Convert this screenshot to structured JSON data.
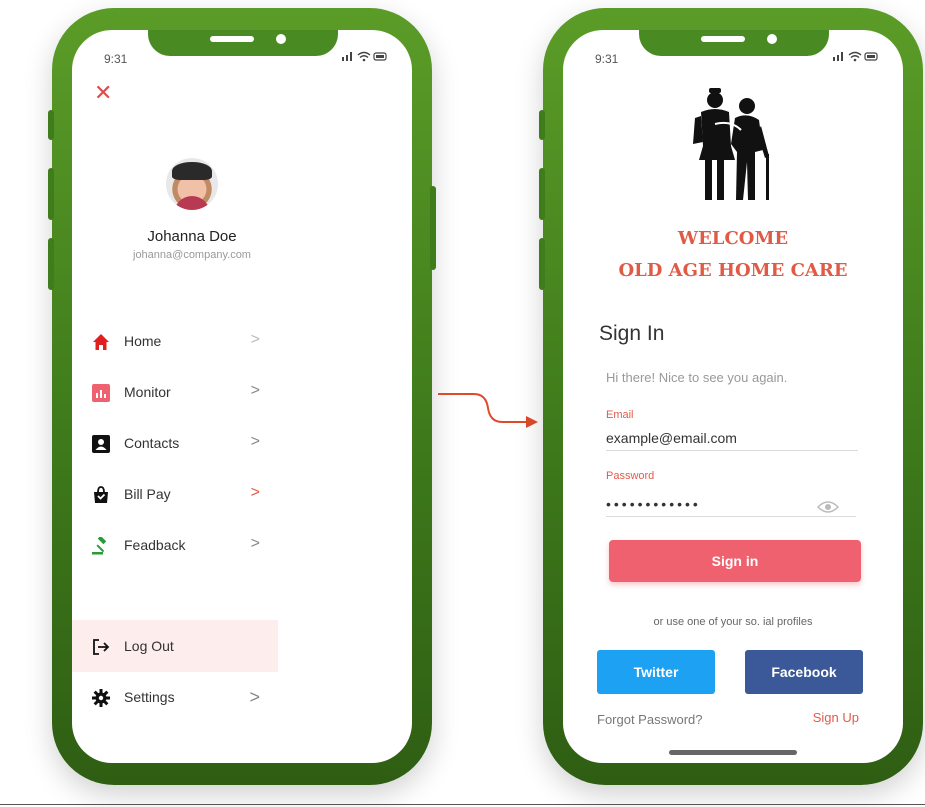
{
  "colors": {
    "frame_green": "#4a8a22",
    "accent_red": "#e05b45",
    "signin_button": "#f0616f",
    "twitter": "#1da1f2",
    "facebook": "#3b5998",
    "logout_highlight": "#fdeeed"
  },
  "left_phone": {
    "status_time": "9:31",
    "close_icon": "close-icon",
    "profile": {
      "name": "Johanna Doe",
      "email": "johanna@company.com"
    },
    "menu": [
      {
        "label": "Home",
        "icon": "home-icon",
        "chevron": ">"
      },
      {
        "label": "Monitor",
        "icon": "chart-icon",
        "chevron": ">"
      },
      {
        "label": "Contacts",
        "icon": "contacts-icon",
        "chevron": ">"
      },
      {
        "label": "Bill Pay",
        "icon": "shopping-bag-icon",
        "chevron": ">"
      },
      {
        "label": "Feadback",
        "icon": "gavel-icon",
        "chevron": ">"
      }
    ],
    "logout": {
      "label": "Log Out",
      "icon": "logout-icon"
    },
    "settings": {
      "label": "Settings",
      "icon": "gear-icon",
      "chevron": ">"
    }
  },
  "right_phone": {
    "status_time": "9:31",
    "logo_icon": "elderly-care-icon",
    "welcome_line1": "WELCOME",
    "welcome_line2": "OLD AGE HOME CARE",
    "title": "Sign In",
    "greeting": "Hi there! Nice to see you again.",
    "email": {
      "label": "Email",
      "value": "example@email.com"
    },
    "password": {
      "label": "Password",
      "value": "••••••••••••"
    },
    "signin_button": "Sign in",
    "social_hint": "or use one of your so. ial profiles",
    "twitter_button": "Twitter",
    "facebook_button": "Facebook",
    "forgot_password": "Forgot Password?",
    "sign_up": "Sign Up"
  }
}
